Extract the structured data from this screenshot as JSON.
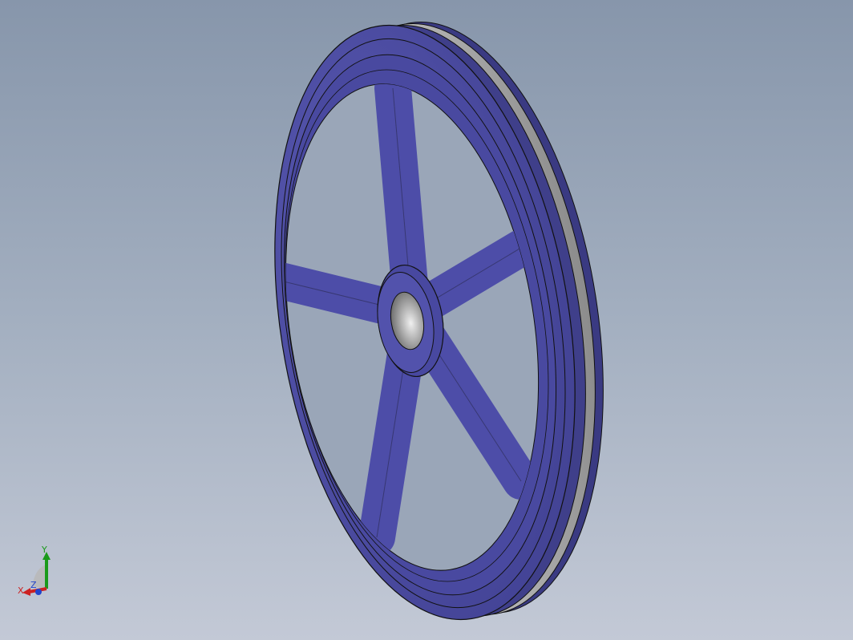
{
  "viewport": {
    "background_top": "#8796ab",
    "background_bottom": "#c3c9d6"
  },
  "model": {
    "type": "spoked-pulley",
    "spoke_count": 5,
    "face_color": "#4f4fa6",
    "groove_color": "#a6a6a6",
    "bore_color": "#8a8a8a"
  },
  "triad": {
    "x_label": "X",
    "y_label": "Y",
    "z_label": "Z",
    "x_color": "#cc2222",
    "y_color": "#22aa22",
    "z_color": "#2244cc"
  }
}
